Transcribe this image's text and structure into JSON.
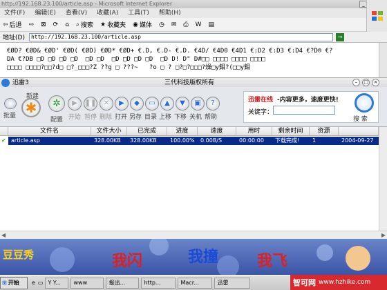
{
  "browser": {
    "title": "http://192.168.23.100/article.asp - Microsoft Internet Explorer",
    "menu": [
      "文件(F)",
      "编辑(E)",
      "查看(V)",
      "收藏(A)",
      "工具(T)",
      "帮助(H)"
    ],
    "toolbar": {
      "back": "后退",
      "search": "搜索",
      "favorites": "收藏夹",
      "media": "媒体"
    },
    "address_label": "地址(D)",
    "address_value": "http://192.168.23.100/article.asp",
    "go": "→",
    "page_line1": "€ØD? €ØD& €ØD' €ØD( €ØD) €ØD* €ØD+ €.D, €.D- €.D. €4D/ €4D0 €4D1 €:D2 €:D3 €:D4 €?D® €?",
    "page_line2": "DA €?DB □D □D □D □D  □D □D  □D □D □D □D  □D D! D\" D#□□ □□□□ □□□□ □□□□",
    "page_line3": "□□□□ □□□□?□□?d□ □?_□□□?Z ??g □ ???~   ?o □ ? □?□?□□□?燥□y鉬?(□□y鉬"
  },
  "xunlei": {
    "app_title": "迅雷3",
    "center_title": "三代科技版权所有",
    "new_label": "新建",
    "batch_label": "批量",
    "config_label": "配置",
    "actions": [
      "开始",
      "暂停",
      "删除",
      "打开",
      "另存",
      "目录",
      "上移",
      "下移",
      "关机",
      "帮助"
    ],
    "promo_red": "迅雷在线",
    "promo_text": "-内容更多，速度更快!",
    "keyword_label": "关键字：",
    "search_button": "搜 索",
    "columns": [
      "文件名",
      "文件大小",
      "已完成",
      "进度",
      "速度",
      "用时",
      "剩余时间",
      "资源",
      ""
    ],
    "row": [
      "article.asp",
      "328.00KB",
      "328.00KB",
      "100.00%",
      "0.00B/S",
      "00:00:00",
      "下载完成!",
      "1",
      "2004-09-27"
    ],
    "banner": {
      "logo": "豆豆秀",
      "t1": "我闪",
      "t2": "我撞",
      "t3": "我飞"
    }
  },
  "taskbar": {
    "start": "开始",
    "items": [
      "Y Y...",
      "www",
      "报出...",
      "http...",
      "Macr...",
      "迅雷"
    ],
    "watermark_cn": "智可网",
    "watermark_url": "www.hzhike.com"
  },
  "colors": {
    "row_select": "#0a2a8a",
    "promo_red": "#d01818",
    "banner": "#4a63b6"
  }
}
